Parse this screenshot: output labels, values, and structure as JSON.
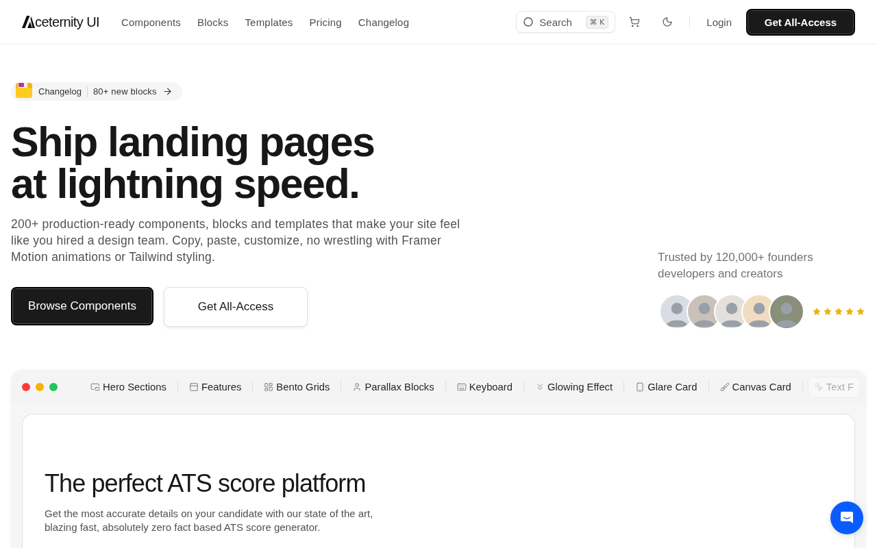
{
  "header": {
    "brand": "ceternity UI",
    "nav": [
      "Components",
      "Blocks",
      "Templates",
      "Pricing",
      "Changelog"
    ],
    "search": {
      "placeholder": "Search",
      "shortcut": "⌘ K"
    },
    "login": "Login",
    "cta": "Get All-Access"
  },
  "hero": {
    "badge": {
      "label": "Changelog",
      "text": "80+ new blocks"
    },
    "title_lines": [
      "Ship landing pages",
      "at lightning speed."
    ],
    "description": "200+ production-ready components, blocks and templates that make your site feel like you hired a design team. Copy, paste, customize, no wrestling with Framer Motion animations or Tailwind styling.",
    "buttons": [
      {
        "label": "Browse Components",
        "kind": "primary"
      },
      {
        "label": "Get All-Access",
        "kind": "secondary"
      }
    ],
    "trust": {
      "text": "Trusted by 120,000+ founders developers and creators",
      "stars": 5
    }
  },
  "preview": {
    "tabs": [
      {
        "label": "Hero Sections",
        "selected": false
      },
      {
        "label": "Features",
        "selected": false
      },
      {
        "label": "Bento Grids",
        "selected": false
      },
      {
        "label": "Parallax Blocks",
        "selected": false
      },
      {
        "label": "Keyboard",
        "selected": false
      },
      {
        "label": "Glowing Effect",
        "selected": false
      },
      {
        "label": "Glare Card",
        "selected": false
      },
      {
        "label": "Canvas Card",
        "selected": false
      },
      {
        "label": "Text F",
        "selected": true
      }
    ],
    "card": {
      "title": "The perfect ATS score platform",
      "description": "Get the most accurate details on your candidate with our state of the art, blazing fast, absolutely zero fact based ATS score generator."
    }
  }
}
